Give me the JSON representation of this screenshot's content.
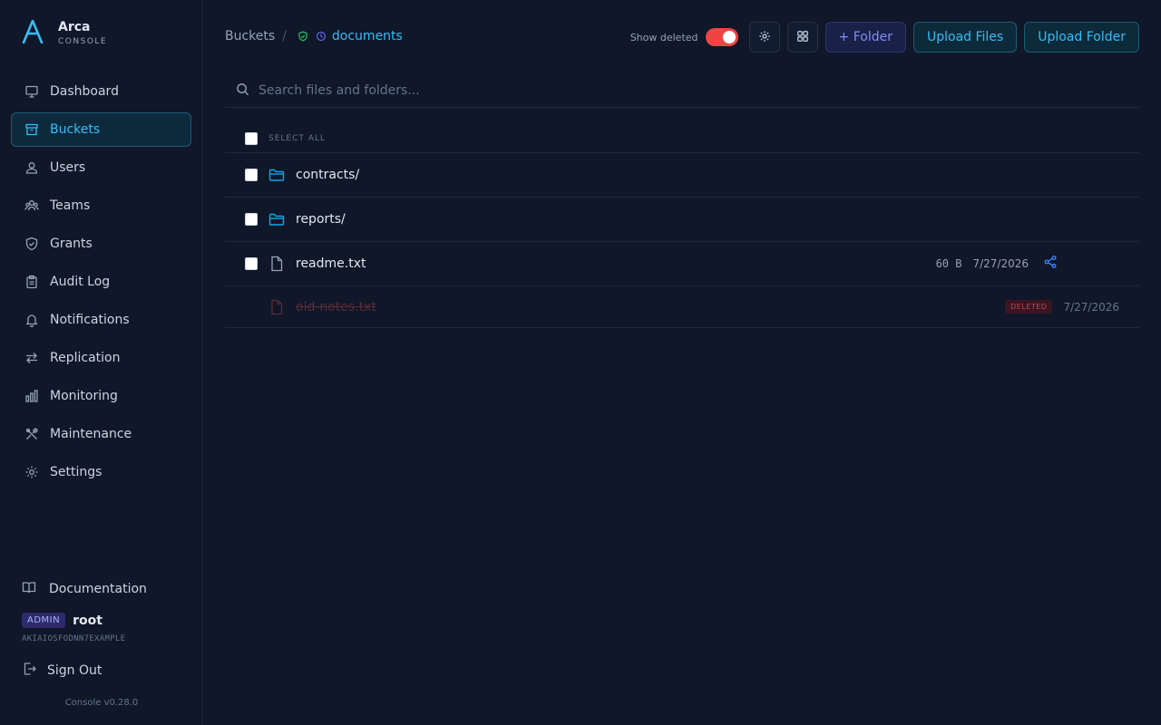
{
  "brand": {
    "title": "Arca",
    "subtitle": "CONSOLE"
  },
  "nav": {
    "items": [
      {
        "label": "Dashboard",
        "icon": "monitor-icon"
      },
      {
        "label": "Buckets",
        "icon": "archive-icon",
        "active": true
      },
      {
        "label": "Users",
        "icon": "user-icon"
      },
      {
        "label": "Teams",
        "icon": "users-icon"
      },
      {
        "label": "Grants",
        "icon": "shield-icon"
      },
      {
        "label": "Audit Log",
        "icon": "clipboard-icon"
      },
      {
        "label": "Notifications",
        "icon": "bell-icon"
      },
      {
        "label": "Replication",
        "icon": "arrows-icon"
      },
      {
        "label": "Monitoring",
        "icon": "bar-chart-icon"
      },
      {
        "label": "Maintenance",
        "icon": "tools-icon"
      },
      {
        "label": "Settings",
        "icon": "gear-icon"
      }
    ]
  },
  "footer": {
    "documentation": "Documentation",
    "role_badge": "ADMIN",
    "username": "root",
    "access_key": "AKIAIOSFODNN7EXAMPLE",
    "sign_out": "Sign Out",
    "version": "Console v0.28.0"
  },
  "breadcrumb": {
    "root": "Buckets",
    "separator": "/",
    "current": "documents"
  },
  "toolbar": {
    "show_deleted_label": "Show deleted",
    "show_deleted_on": true,
    "new_folder": "+ Folder",
    "upload_files": "Upload Files",
    "upload_folder": "Upload Folder"
  },
  "search": {
    "placeholder": "Search files and folders..."
  },
  "list": {
    "select_all": "SELECT ALL",
    "items": [
      {
        "name": "contracts/",
        "type": "folder"
      },
      {
        "name": "reports/",
        "type": "folder"
      },
      {
        "name": "readme.txt",
        "type": "file",
        "size": "60 B",
        "date": "7/27/2026"
      },
      {
        "name": "old-notes.txt",
        "type": "file",
        "deleted": true,
        "badge": "DELETED",
        "date": "7/27/2026"
      }
    ]
  },
  "colors": {
    "accent": "#38bdf8",
    "folder_accent": "#818cf8",
    "danger": "#ef4444",
    "background": "#0f1729"
  }
}
